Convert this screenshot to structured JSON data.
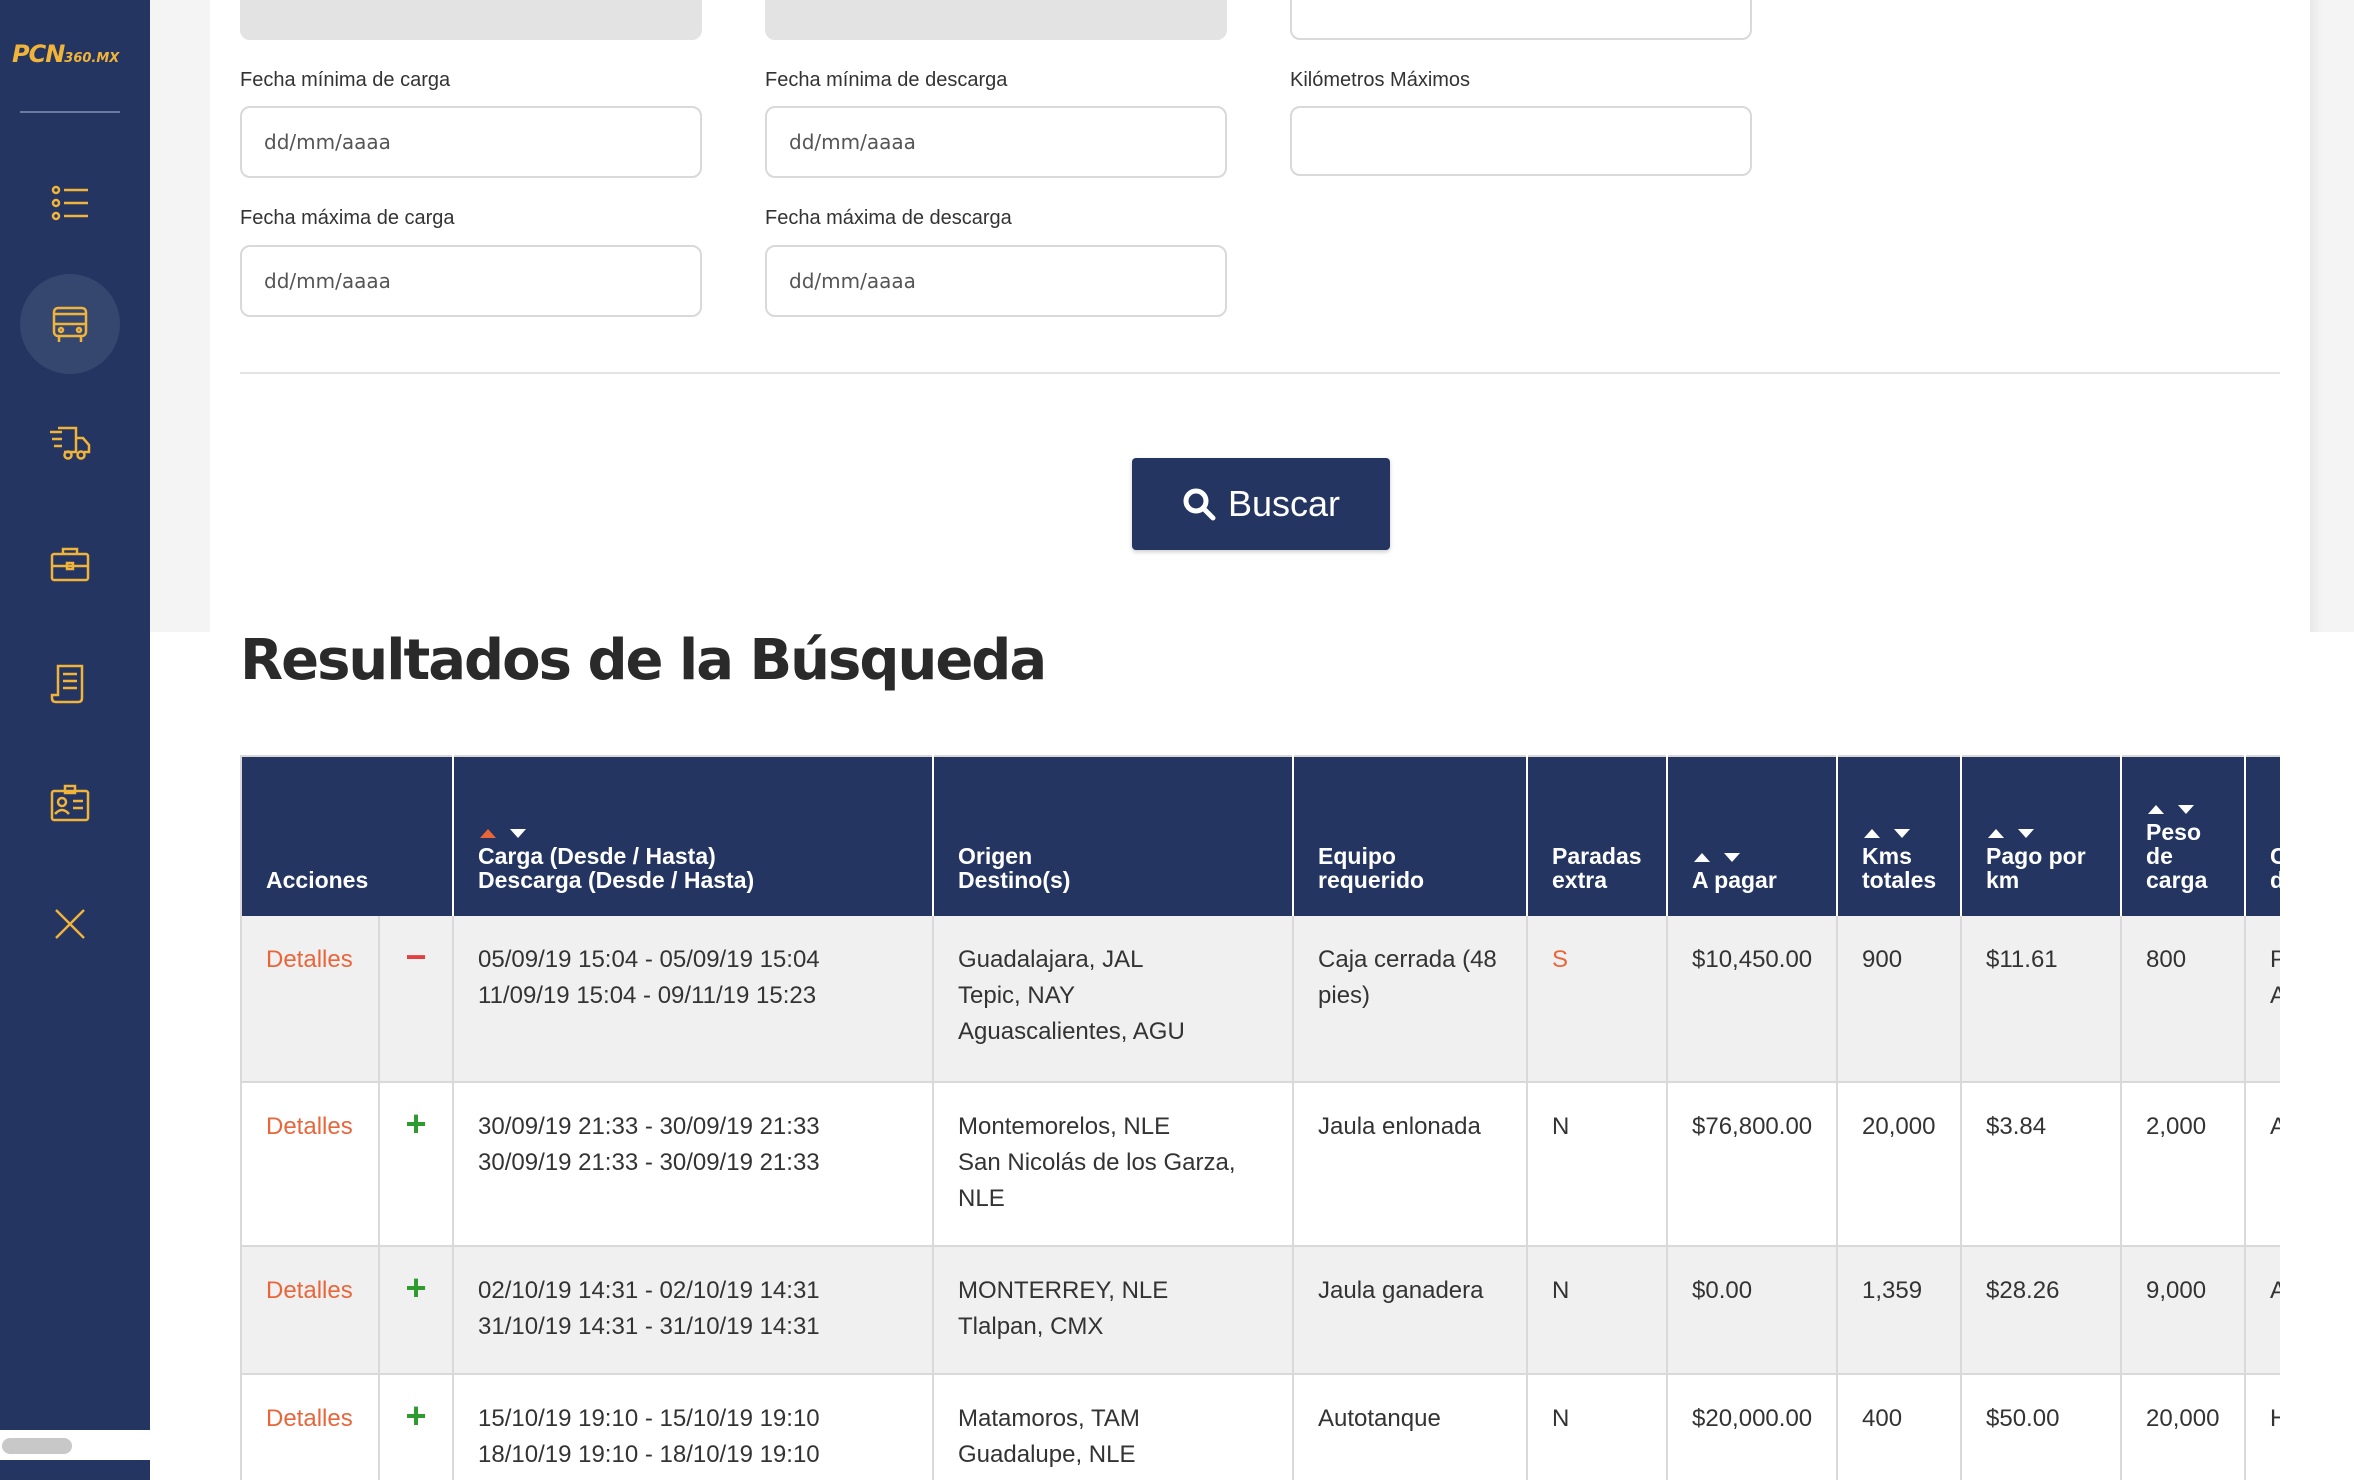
{
  "brand": {
    "logo_main": "PCN",
    "logo_sub": "360.MX"
  },
  "sidebar": {
    "items": [
      {
        "icon": "list-icon",
        "active": false
      },
      {
        "icon": "bus-icon",
        "active": true
      },
      {
        "icon": "delivery-truck-icon",
        "active": false
      },
      {
        "icon": "briefcase-icon",
        "active": false
      },
      {
        "icon": "document-icon",
        "active": false
      },
      {
        "icon": "id-badge-icon",
        "active": false
      },
      {
        "icon": "close-icon",
        "active": false
      }
    ]
  },
  "filters": {
    "min_load_date": {
      "label": "Fecha mínima de carga",
      "placeholder": "dd/mm/aaaa"
    },
    "min_unload_date": {
      "label": "Fecha mínima de descarga",
      "placeholder": "dd/mm/aaaa"
    },
    "max_km": {
      "label": "Kilómetros Máximos",
      "placeholder": ""
    },
    "max_load_date": {
      "label": "Fecha máxima de carga",
      "placeholder": "dd/mm/aaaa"
    },
    "max_unload_date": {
      "label": "Fecha máxima de descarga",
      "placeholder": "dd/mm/aaaa"
    }
  },
  "search_button": {
    "label": "Buscar"
  },
  "results": {
    "title": "Resultados de la Búsqueda",
    "columns": {
      "actions": "Acciones",
      "dates_line1": "Carga (Desde / Hasta)",
      "dates_line2": "Descarga (Desde / Hasta)",
      "route_line1": "Origen",
      "route_line2": "Destino(s)",
      "equipment": "Equipo requerido",
      "stops_line1": "Paradas",
      "stops_line2": "extra",
      "pay": "A pagar",
      "kms_line1": "Kms",
      "kms_line2": "totales",
      "perkm_line1": "Pago por",
      "perkm_line2": "km",
      "weight_line1": "Peso",
      "weight_line2": "de",
      "weight_line3": "carga",
      "extra_line1": "C",
      "extra_line2": "d"
    },
    "rows": [
      {
        "details": "Detalles",
        "sign": "−",
        "load_dates": "05/09/19 15:04 - 05/09/19 15:04",
        "unload_dates": "11/09/19 15:04 - 09/11/19 15:23",
        "origin": "Guadalajara, JAL",
        "dest1": "Tepic, NAY",
        "dest2": "Aguascalientes, AGU",
        "equipment": "Caja cerrada (48 pies)",
        "stops": "S",
        "pay": "$10,450.00",
        "kms": "900",
        "per_km": "$11.61",
        "weight": "800",
        "extra1": "P",
        "extra2": "A"
      },
      {
        "details": "Detalles",
        "sign": "+",
        "load_dates": "30/09/19 21:33 - 30/09/19 21:33",
        "unload_dates": "30/09/19 21:33 - 30/09/19 21:33",
        "origin": "Montemorelos, NLE",
        "dest1": "San Nicolás de los Garza, NLE",
        "equipment": "Jaula enlonada",
        "stops": "N",
        "pay": "$76,800.00",
        "kms": "20,000",
        "per_km": "$3.84",
        "weight": "2,000",
        "extra1": "A"
      },
      {
        "details": "Detalles",
        "sign": "+",
        "load_dates": "02/10/19 14:31 - 02/10/19 14:31",
        "unload_dates": "31/10/19 14:31 - 31/10/19 14:31",
        "origin": "MONTERREY, NLE",
        "dest1": "Tlalpan, CMX",
        "equipment": "Jaula ganadera",
        "stops": "N",
        "pay": "$0.00",
        "kms": "1,359",
        "per_km": "$28.26",
        "weight": "9,000",
        "extra1": "A"
      },
      {
        "details": "Detalles",
        "sign": "+",
        "load_dates": "15/10/19 19:10 - 15/10/19 19:10",
        "unload_dates": "18/10/19 19:10 - 18/10/19 19:10",
        "origin": "Matamoros, TAM",
        "dest1": "Guadalupe, NLE",
        "equipment": "Autotanque",
        "stops": "N",
        "pay": "$20,000.00",
        "kms": "400",
        "per_km": "$50.00",
        "weight": "20,000",
        "extra1": "H"
      }
    ]
  },
  "colors": {
    "sidebar": "#243562",
    "accent": "#e9663b",
    "icon": "#f0b43a",
    "plus": "#2e9b2e",
    "minus": "#e04040"
  }
}
